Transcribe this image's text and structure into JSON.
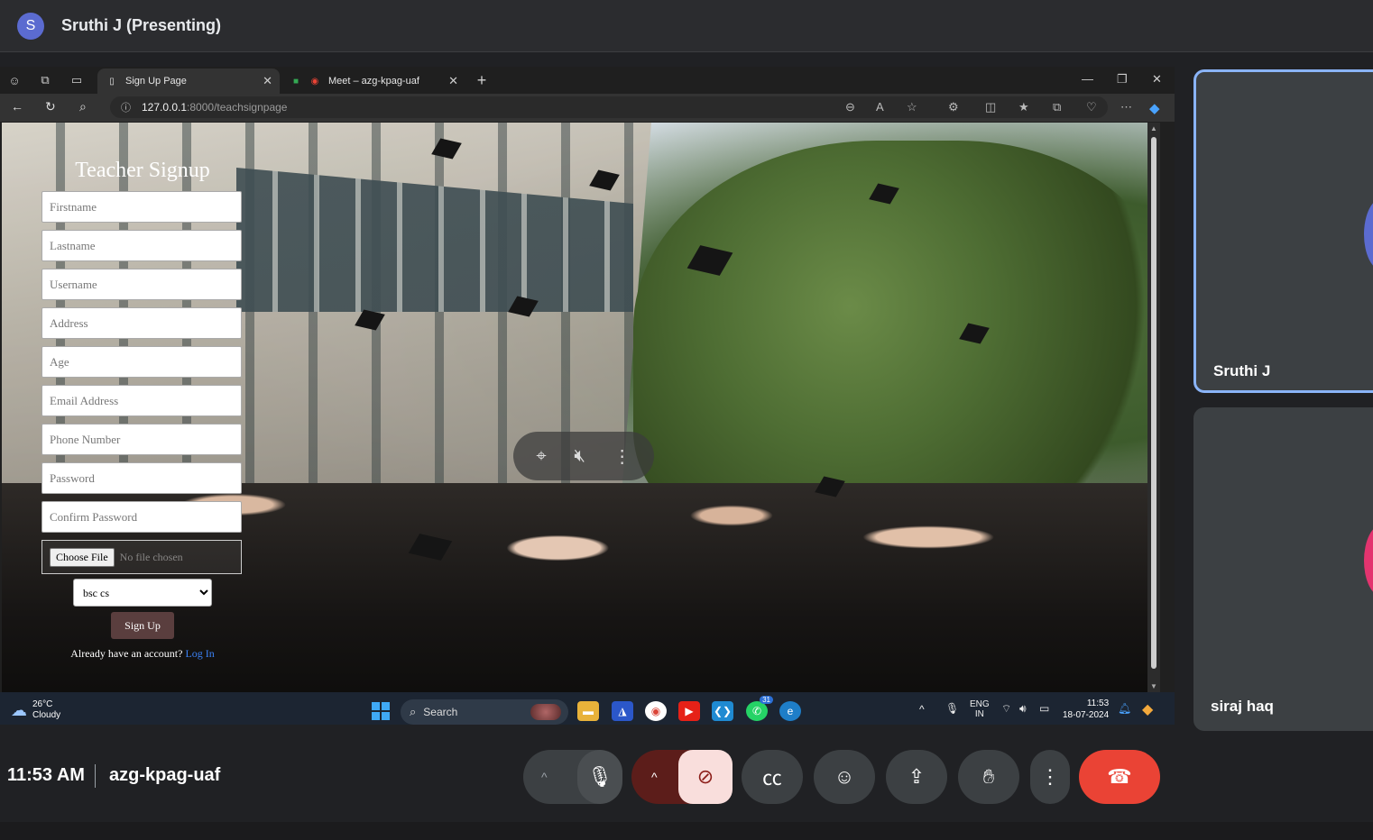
{
  "meet": {
    "presenter_initial": "S",
    "presenter_label": "Sruthi J (Presenting)",
    "time": "11:53 AM",
    "meeting_code": "azg-kpag-uaf",
    "participants": [
      {
        "name": "Sruthi J"
      },
      {
        "name": "siraj haq"
      }
    ],
    "controls": {
      "more_options": "⋮",
      "end_call": "end-call-icon"
    }
  },
  "browser": {
    "tabs": [
      {
        "title": "Sign Up Page",
        "active": true
      },
      {
        "title": "Meet – azg-kpag-uaf",
        "active": false
      }
    ],
    "url_host": "127.0.0.1",
    "url_path": ":8000/teachsignpage"
  },
  "page": {
    "title": "Teacher Signup",
    "fields": {
      "firstname": "Firstname",
      "lastname": "Lastname",
      "username": "Username",
      "address": "Address",
      "age": "Age",
      "email": "Email Address",
      "phone": "Phone Number",
      "password": "Password",
      "confirm_password": "Confirm Password"
    },
    "file_button": "Choose File",
    "file_status": "No file chosen",
    "course_selected": "bsc cs",
    "submit_label": "Sign Up",
    "login_prompt": "Already have an account?",
    "login_link": "Log In"
  },
  "taskbar": {
    "temperature": "26°C",
    "weather": "Cloudy",
    "search_placeholder": "Search",
    "whatsapp_badge": "31",
    "lang_line1": "ENG",
    "lang_line2": "IN",
    "clock_time": "11:53",
    "clock_date": "18-07-2024"
  },
  "colors": {
    "end_call": "#ea4335",
    "camera_off": "#f9dedc",
    "active_tile_border": "#8ab4f8"
  }
}
